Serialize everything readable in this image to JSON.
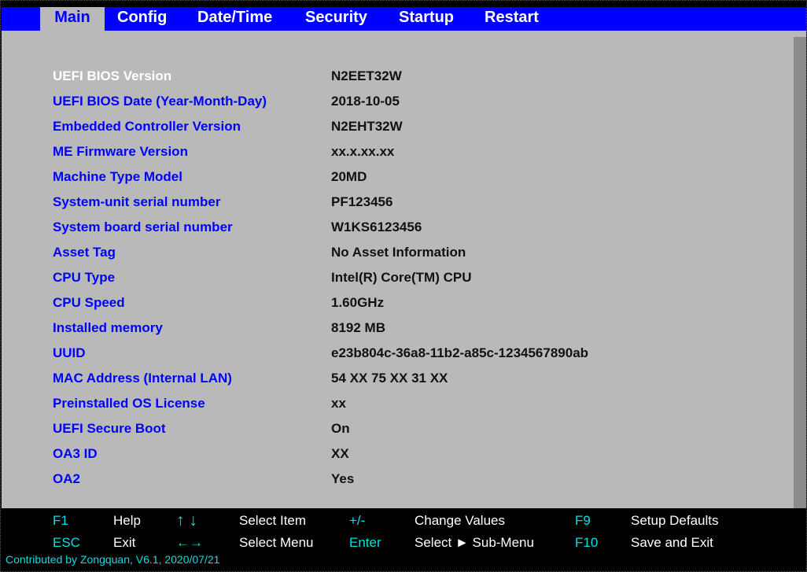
{
  "tabs": [
    {
      "label": "Main",
      "active": true
    },
    {
      "label": "Config",
      "active": false
    },
    {
      "label": "Date/Time",
      "active": false
    },
    {
      "label": "Security",
      "active": false
    },
    {
      "label": "Startup",
      "active": false
    },
    {
      "label": "Restart",
      "active": false
    }
  ],
  "main": {
    "rows": [
      {
        "label": "UEFI BIOS Version",
        "value": "N2EET32W",
        "selected": true
      },
      {
        "label": "UEFI BIOS Date (Year-Month-Day)",
        "value": "2018-10-05"
      },
      {
        "label": "Embedded Controller Version",
        "value": "N2EHT32W"
      },
      {
        "label": "ME Firmware Version",
        "value": "xx.x.xx.xx"
      },
      {
        "label": "Machine Type Model",
        "value": "20MD"
      },
      {
        "label": "System-unit serial number",
        "value": "PF123456"
      },
      {
        "label": "System board serial number",
        "value": "W1KS6123456"
      },
      {
        "label": "Asset Tag",
        "value": "No Asset Information"
      },
      {
        "label": "CPU Type",
        "value": "Intel(R) Core(TM) CPU"
      },
      {
        "label": "CPU Speed",
        "value": "1.60GHz"
      },
      {
        "label": "Installed memory",
        "value": "8192 MB"
      },
      {
        "label": "UUID",
        "value": "e23b804c-36a8-11b2-a85c-1234567890ab"
      },
      {
        "label": "MAC Address (Internal LAN)",
        "value": "54 XX 75 XX 31 XX"
      },
      {
        "label": "Preinstalled OS License",
        "value": "xx"
      },
      {
        "label": "UEFI Secure Boot",
        "value": "On"
      },
      {
        "label": "OA3 ID",
        "value": "XX"
      },
      {
        "label": "OA2",
        "value": "Yes"
      }
    ]
  },
  "footer": {
    "f1_key": "F1",
    "f1_label": "Help",
    "updown_key": "↑ ↓",
    "updown_label": "Select Item",
    "plusminus_key": "+/-",
    "plusminus_label": "Change Values",
    "f9_key": "F9",
    "f9_label": "Setup Defaults",
    "esc_key": "ESC",
    "esc_label": "Exit",
    "leftright_key": "←→",
    "leftright_label": "Select Menu",
    "enter_key": "Enter",
    "enter_label": "Select ► Sub-Menu",
    "f10_key": "F10",
    "f10_label": "Save and Exit",
    "credit": "Contributed by Zongquan, V6.1, 2020/07/21"
  },
  "colors": {
    "menu_bar": "#0000ff",
    "panel": "#b9b9b9",
    "label": "#0000ff",
    "key_hint": "#00e0e0"
  }
}
